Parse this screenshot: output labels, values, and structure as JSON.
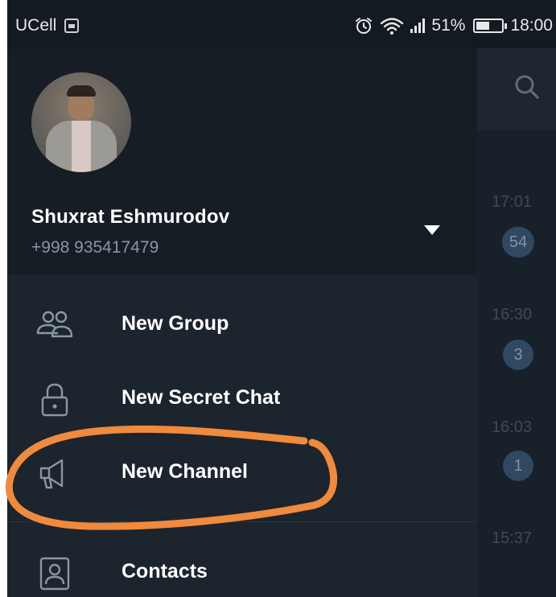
{
  "status_bar": {
    "carrier": "UCell",
    "battery_percent": "51%",
    "time": "18:00",
    "battery_level": 0.51,
    "icons": [
      "sim-icon",
      "alarm-icon",
      "wifi-icon",
      "signal-icon",
      "battery-icon"
    ]
  },
  "profile": {
    "name": "Shuxrat Eshmurodov",
    "phone": "+998 935417479"
  },
  "menu": {
    "items": [
      {
        "label": "New Group",
        "icon": "people-icon"
      },
      {
        "label": "New Secret Chat",
        "icon": "lock-icon"
      },
      {
        "label": "New Channel",
        "icon": "megaphone-icon"
      },
      {
        "label": "Contacts",
        "icon": "contact-icon"
      }
    ]
  },
  "chat_list": {
    "items": [
      {
        "time": "17:01",
        "unread": "54"
      },
      {
        "time": "16:30",
        "unread": "3"
      },
      {
        "time": "16:03",
        "unread": "1"
      },
      {
        "time": "15:37",
        "unread": ""
      }
    ]
  },
  "colors": {
    "drawer_bg": "#1c242e",
    "header_bg": "#161d25",
    "status_bg": "#141a21",
    "badge_bg": "#304860",
    "annotation": "#f08a3c",
    "icon_color": "#8a96a3"
  }
}
